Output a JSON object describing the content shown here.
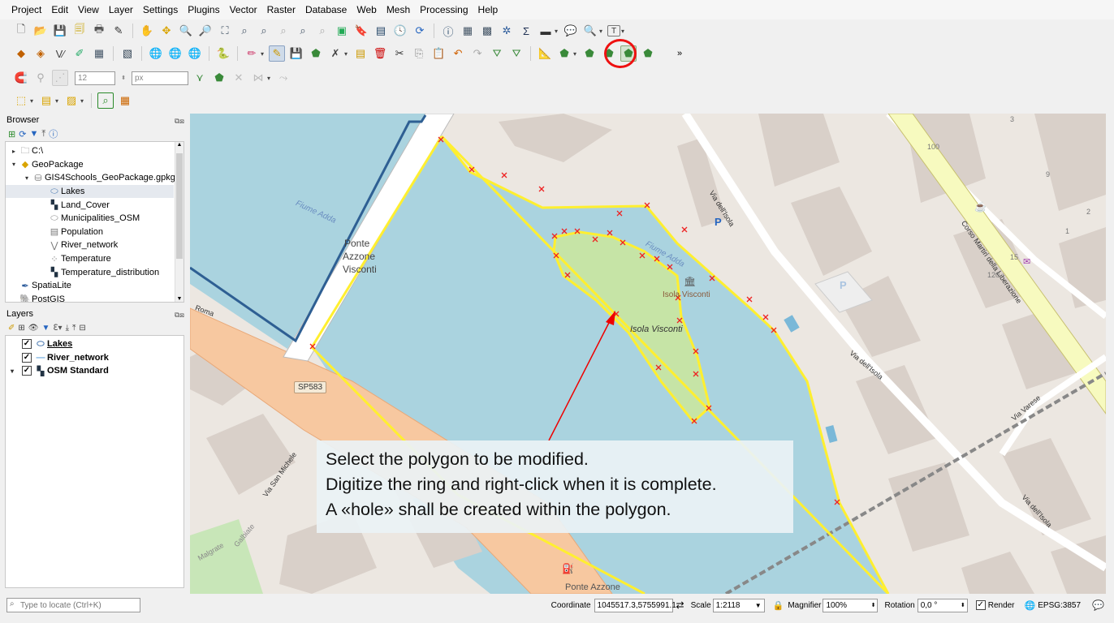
{
  "menubar": {
    "items": [
      "Project",
      "Edit",
      "View",
      "Layer",
      "Settings",
      "Plugins",
      "Vector",
      "Raster",
      "Database",
      "Web",
      "Mesh",
      "Processing",
      "Help"
    ]
  },
  "toolbar_digitize": {
    "font_size_value": "12",
    "unit_value": "px",
    "highlight_color": "#e11"
  },
  "browser": {
    "title": "Browser",
    "items": [
      {
        "label": "C:\\",
        "icon": "folder-icon"
      },
      {
        "label": "GeoPackage",
        "icon": "geopackage-icon"
      },
      {
        "label": "GIS4Schools_GeoPackage.gpkg",
        "icon": "database-icon"
      },
      {
        "label": "Lakes",
        "icon": "polygon-layer-icon"
      },
      {
        "label": "Land_Cover",
        "icon": "raster-layer-icon"
      },
      {
        "label": "Municipalities_OSM",
        "icon": "polygon-layer-icon"
      },
      {
        "label": "Population",
        "icon": "table-icon"
      },
      {
        "label": "River_network",
        "icon": "line-layer-icon"
      },
      {
        "label": "Temperature",
        "icon": "point-layer-icon"
      },
      {
        "label": "Temperature_distribution",
        "icon": "raster-layer-icon"
      },
      {
        "label": "SpatiaLite",
        "icon": "spatialite-icon"
      },
      {
        "label": "PostGIS",
        "icon": "postgis-icon"
      }
    ]
  },
  "layers": {
    "title": "Layers",
    "items": [
      {
        "label": "Lakes",
        "checked": true
      },
      {
        "label": "River_network",
        "checked": true
      },
      {
        "label": "OSM Standard",
        "checked": true
      }
    ]
  },
  "map_labels": {
    "ponte_line1": "Ponte",
    "ponte_line2": "Azzone",
    "ponte_line3": "Visconti",
    "fiume_adda_left": "Fiume Adda",
    "fiume_adda_right": "Fiume Adda",
    "isola_visconti_poi": "Isola Visconti",
    "isola_visconti_label": "Isola Visconti",
    "via_dell_isola_1": "Via dell'Isola",
    "via_dell_isola_2": "Via dell'Isola",
    "via_dell_isola_3": "Via dell'Isola",
    "corso_martiri": "Corso Martiri della Liberazione",
    "via_varese": "Via Varese",
    "via_roma": "Roma",
    "sp583": "SP583",
    "via_san_michele": "Via San Michele",
    "galbiate": "Galbiate",
    "malgrate": "Malgrate",
    "ponte_azzone_bottom": "Ponte Azzone",
    "num_100": "100",
    "num_120": "120",
    "num_115": "15",
    "num_3": "3",
    "num_9": "9",
    "num_2": "2",
    "num_1": "1",
    "parking_p": "P"
  },
  "caption": {
    "line1": "Select the polygon to be modified.",
    "line2": "Digitize the ring and right-click when it is complete.",
    "line3": "A «hole» shall be created within the polygon."
  },
  "statusbar": {
    "locate_placeholder": "Type to locate (Ctrl+K)",
    "coordinate_label": "Coordinate",
    "coordinate_value": "1045517.3,5755991.1",
    "scale_label": "Scale",
    "scale_value": "1:2118",
    "magnifier_label": "Magnifier",
    "magnifier_value": "100%",
    "rotation_label": "Rotation",
    "rotation_value": "0,0 °",
    "render_label": "Render",
    "crs_label": "EPSG:3857"
  }
}
